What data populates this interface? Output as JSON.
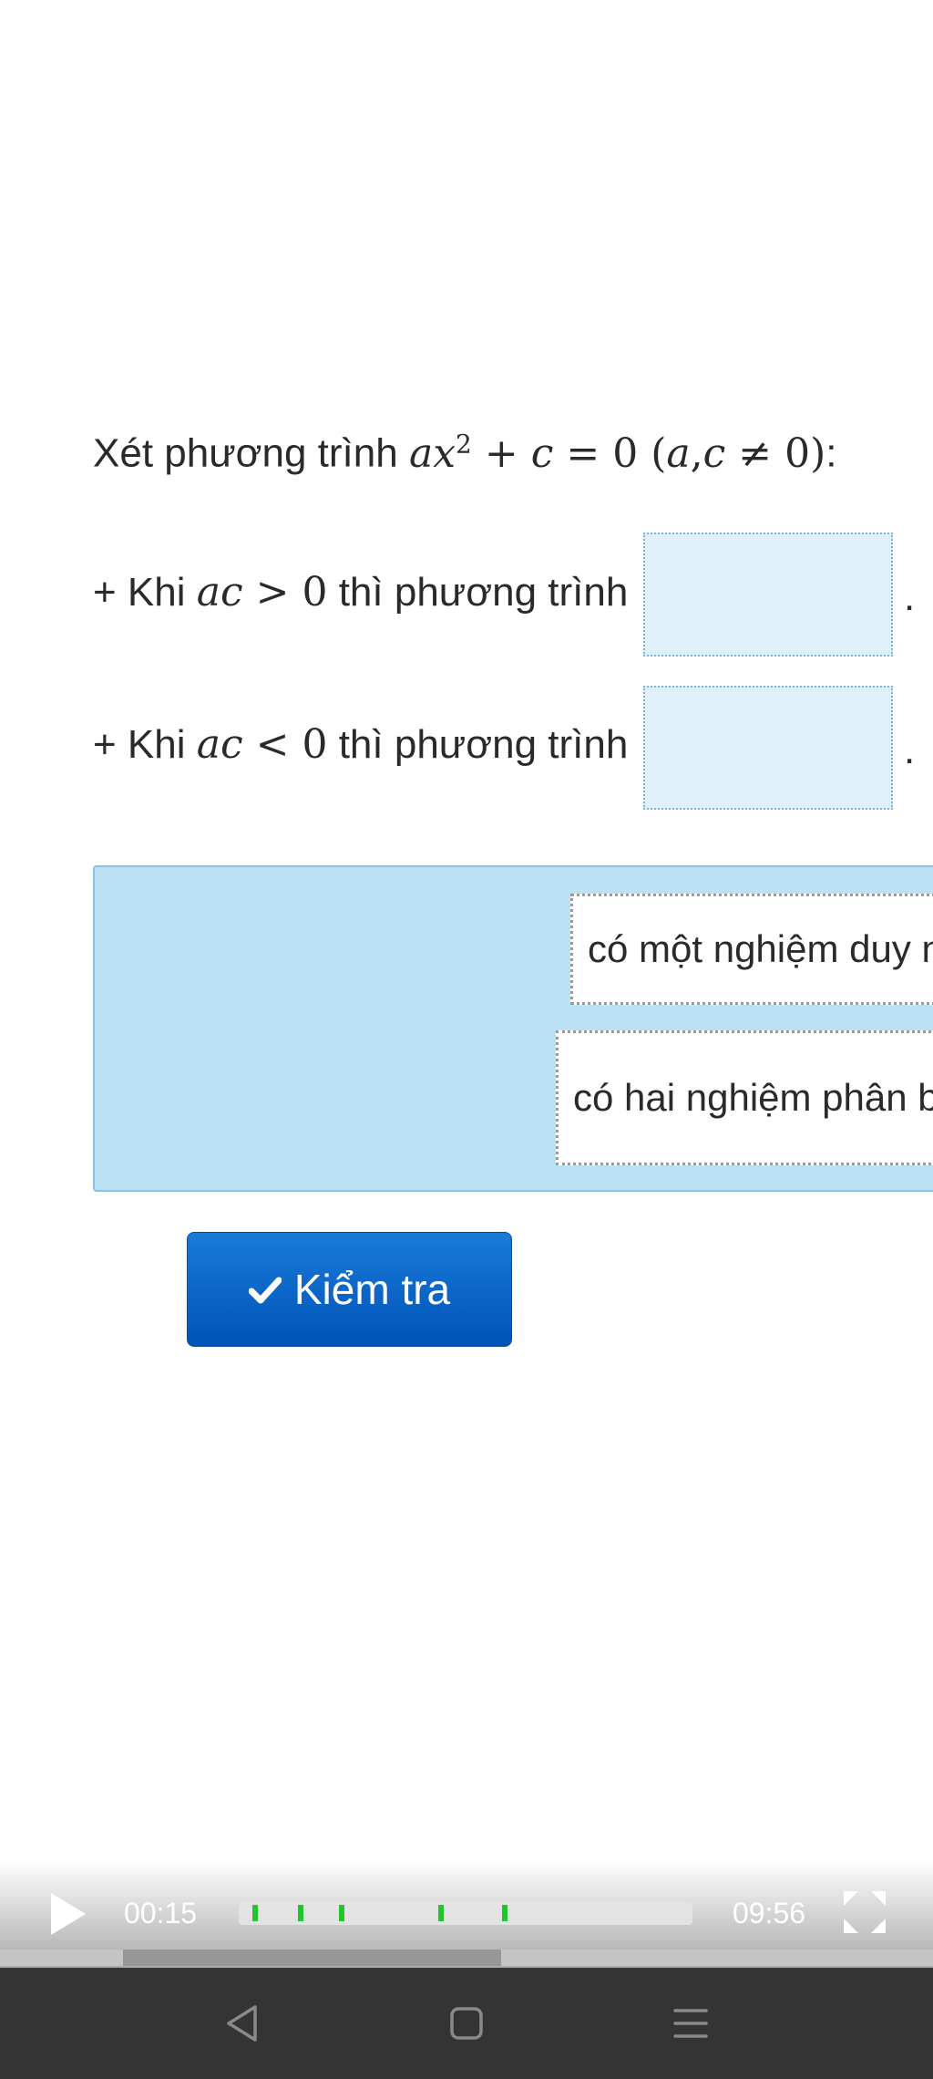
{
  "question": {
    "intro_text": "Xét phương trình",
    "intro_tail": ":",
    "equation": {
      "a": "a",
      "x": "x",
      "exp": "2",
      "plus": " + ",
      "c": "c",
      "eq": " = ",
      "zero": "0",
      "cond_open": " (",
      "cond_a": "a",
      "cond_comma": ",",
      "cond_c": "c",
      "cond_neq": " ≠ ",
      "cond_zero": "0",
      "cond_close": ")"
    },
    "lines": [
      {
        "prefix": "+ Khi",
        "var": "ac",
        "op": " > ",
        "val": "0",
        "suffix": "thì phương trình",
        "end": "."
      },
      {
        "prefix": "+ Khi",
        "var": "ac",
        "op": " < ",
        "val": "0",
        "suffix": "thì phương trình",
        "end": "."
      }
    ]
  },
  "answer_bank": {
    "options": [
      "có một nghiệm duy nhất",
      "có hai nghiệm phân biệt"
    ]
  },
  "check_button": {
    "label": "Kiểm tra",
    "icon": "checkmark-icon"
  },
  "player": {
    "current_time": "00:15",
    "total_time": "09:56",
    "markers": [
      0.03,
      0.13,
      0.22,
      0.44,
      0.58
    ],
    "icons": [
      "play-icon",
      "fullscreen-icon"
    ]
  },
  "nav_icons": [
    "back-icon",
    "home-icon",
    "recents-icon"
  ],
  "colors": {
    "accent": "#0a63c9",
    "dropzone": "#dff0fb",
    "bank": "#bde1f4",
    "marker": "#22c52c"
  }
}
